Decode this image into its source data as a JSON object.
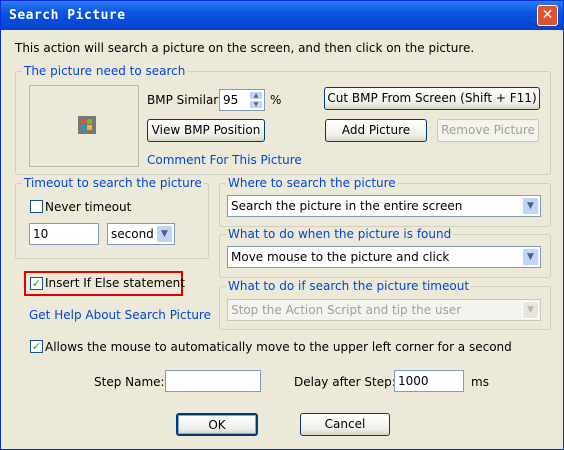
{
  "window": {
    "title": "Search Picture",
    "close_glyph": "✕"
  },
  "intro": "This action will search a picture on the screen, and then click on the picture.",
  "picture_group": {
    "label": "The picture need to search",
    "bmp_similar_label": "BMP Similar:",
    "bmp_similar_value": "95",
    "percent": "%",
    "view_position": "View BMP Position",
    "cut_bmp": "Cut BMP From Screen (Shift + F11)",
    "add_picture": "Add Picture",
    "remove_picture": "Remove Picture",
    "comment_link": "Comment For This Picture"
  },
  "timeout_group": {
    "label": "Timeout to search the picture",
    "never_timeout": "Never timeout",
    "never_checked": false,
    "timeout_value": "10",
    "unit": "second"
  },
  "where_group": {
    "label": "Where to search the picture",
    "value": "Search the picture in the entire screen"
  },
  "found_group": {
    "label": "What to do when the picture is found",
    "value": "Move mouse to the picture and click"
  },
  "timeout_action_group": {
    "label": "What to do if search the picture timeout",
    "value": "Stop the Action Script and tip the user"
  },
  "insert_if_else": {
    "label": "Insert If Else statement",
    "checked": true
  },
  "help_link": "Get Help About Search Picture",
  "allow_mouse": {
    "label": "Allows the mouse to automatically move to the upper left corner for a second",
    "checked": true
  },
  "step_name_label": "Step Name:",
  "step_name_value": "",
  "delay_label": "Delay after Step:",
  "delay_value": "1000",
  "delay_unit": "ms",
  "ok": "OK",
  "cancel": "Cancel",
  "check_glyph": "✓",
  "dropdown_glyph": "▼",
  "spin_up_glyph": "▲",
  "spin_down_glyph": "▼"
}
